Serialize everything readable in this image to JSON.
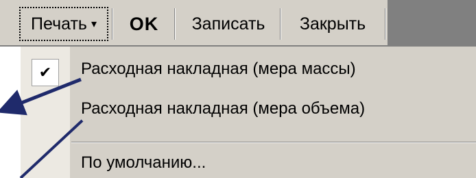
{
  "toolbar": {
    "print_label": "Печать",
    "ok_label": "OK",
    "save_label": "Записать",
    "close_label": "Закрыть"
  },
  "menu": {
    "items": [
      {
        "label": "Расходная накладная (мера массы)",
        "checked": true
      },
      {
        "label": "Расходная накладная (мера объема)",
        "checked": false
      },
      {
        "label": "По умолчанию...",
        "checked": false
      }
    ]
  },
  "annotation": {
    "arrow_color": "#1f2a6b"
  },
  "icons": {
    "check": "checkmark-icon",
    "print_dropdown": "dropdown-arrow-icon"
  }
}
